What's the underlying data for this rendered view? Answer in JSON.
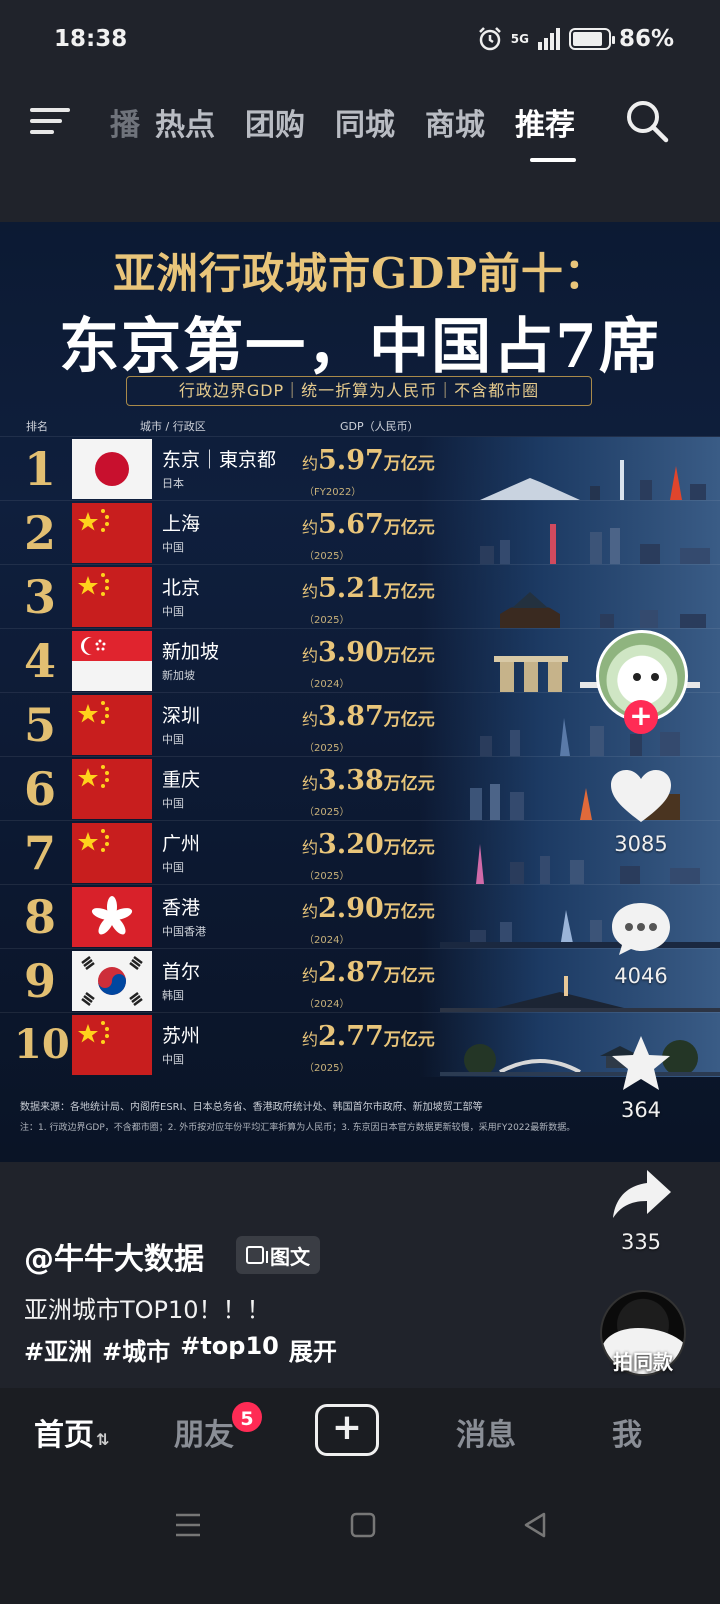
{
  "status_bar": {
    "time": "18:38",
    "network": "5G",
    "battery_percent": "86%",
    "battery_level": 0.86
  },
  "top_nav": {
    "tabs": [
      "播",
      "热点",
      "团购",
      "同城",
      "商城",
      "推荐"
    ],
    "active_tab": "推荐",
    "icons": {
      "menu": "menu-icon",
      "search": "search-icon"
    }
  },
  "poster": {
    "title_line1": "亚洲行政城市GDP前十：",
    "title_line2": "东京第一，中国占7席",
    "subtitle": "行政边界GDP｜统一折算为人民币｜不含都市圈",
    "col_rank": "排名",
    "col_city": "城市 / 行政区",
    "col_gdp": "GDP（人民币）",
    "rows": [
      {
        "rank": "1",
        "city": "东京｜東京都",
        "country": "日本",
        "prefix": "约",
        "value": "5.97",
        "unit": "万亿元",
        "year": "（FY2022）",
        "flag": "japan"
      },
      {
        "rank": "2",
        "city": "上海",
        "country": "中国",
        "prefix": "约",
        "value": "5.67",
        "unit": "万亿元",
        "year": "（2025）",
        "flag": "china"
      },
      {
        "rank": "3",
        "city": "北京",
        "country": "中国",
        "prefix": "约",
        "value": "5.21",
        "unit": "万亿元",
        "year": "（2025）",
        "flag": "china"
      },
      {
        "rank": "4",
        "city": "新加坡",
        "country": "新加坡",
        "prefix": "约",
        "value": "3.90",
        "unit": "万亿元",
        "year": "（2024）",
        "flag": "singapore"
      },
      {
        "rank": "5",
        "city": "深圳",
        "country": "中国",
        "prefix": "约",
        "value": "3.87",
        "unit": "万亿元",
        "year": "（2025）",
        "flag": "china"
      },
      {
        "rank": "6",
        "city": "重庆",
        "country": "中国",
        "prefix": "约",
        "value": "3.38",
        "unit": "万亿元",
        "year": "（2025）",
        "flag": "china"
      },
      {
        "rank": "7",
        "city": "广州",
        "country": "中国",
        "prefix": "约",
        "value": "3.20",
        "unit": "万亿元",
        "year": "（2025）",
        "flag": "china"
      },
      {
        "rank": "8",
        "city": "香港",
        "country": "中国香港",
        "prefix": "约",
        "value": "2.90",
        "unit": "万亿元",
        "year": "（2024）",
        "flag": "hongkong"
      },
      {
        "rank": "9",
        "city": "首尔",
        "country": "韩国",
        "prefix": "约",
        "value": "2.87",
        "unit": "万亿元",
        "year": "（2024）",
        "flag": "korea"
      },
      {
        "rank": "10",
        "city": "苏州",
        "country": "中国",
        "prefix": "约",
        "value": "2.77",
        "unit": "万亿元",
        "year": "（2025）",
        "flag": "china"
      }
    ],
    "source": "数据来源：各地统计局、内阁府ESRI、日本总务省、香港政府统计处、韩国首尔市政府、新加坡贸工部等",
    "note": "注：1. 行政边界GDP，不含都市圈；2. 外币按对应年份平均汇率折算为人民币；3. 东京因日本官方数据更新较慢，采用FY2022最新数据。"
  },
  "actions": {
    "likes": "3085",
    "comments": "4046",
    "favorites": "364",
    "shares": "335",
    "music_label": "拍同款"
  },
  "post": {
    "author": "@牛牛大数据",
    "type_badge": "图文",
    "caption": "亚洲城市TOP10！！！",
    "tags": [
      "#亚洲",
      "#城市",
      "#top10"
    ],
    "expand": "展开"
  },
  "bottom_nav": {
    "home": "首页",
    "friends": "朋友",
    "friends_badge": "5",
    "messages": "消息",
    "me": "我"
  },
  "colors": {
    "accent_red": "#ff2b55",
    "gold": "#e9c57a",
    "background": "#20232b"
  }
}
